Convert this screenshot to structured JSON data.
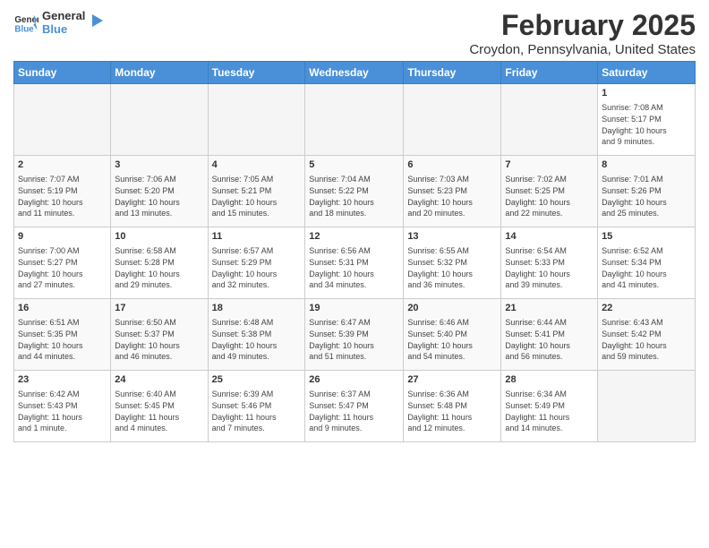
{
  "header": {
    "logo_line1": "General",
    "logo_line2": "Blue",
    "title": "February 2025",
    "subtitle": "Croydon, Pennsylvania, United States"
  },
  "weekdays": [
    "Sunday",
    "Monday",
    "Tuesday",
    "Wednesday",
    "Thursday",
    "Friday",
    "Saturday"
  ],
  "weeks": [
    [
      {
        "day": "",
        "info": ""
      },
      {
        "day": "",
        "info": ""
      },
      {
        "day": "",
        "info": ""
      },
      {
        "day": "",
        "info": ""
      },
      {
        "day": "",
        "info": ""
      },
      {
        "day": "",
        "info": ""
      },
      {
        "day": "1",
        "info": "Sunrise: 7:08 AM\nSunset: 5:17 PM\nDaylight: 10 hours\nand 9 minutes."
      }
    ],
    [
      {
        "day": "2",
        "info": "Sunrise: 7:07 AM\nSunset: 5:19 PM\nDaylight: 10 hours\nand 11 minutes."
      },
      {
        "day": "3",
        "info": "Sunrise: 7:06 AM\nSunset: 5:20 PM\nDaylight: 10 hours\nand 13 minutes."
      },
      {
        "day": "4",
        "info": "Sunrise: 7:05 AM\nSunset: 5:21 PM\nDaylight: 10 hours\nand 15 minutes."
      },
      {
        "day": "5",
        "info": "Sunrise: 7:04 AM\nSunset: 5:22 PM\nDaylight: 10 hours\nand 18 minutes."
      },
      {
        "day": "6",
        "info": "Sunrise: 7:03 AM\nSunset: 5:23 PM\nDaylight: 10 hours\nand 20 minutes."
      },
      {
        "day": "7",
        "info": "Sunrise: 7:02 AM\nSunset: 5:25 PM\nDaylight: 10 hours\nand 22 minutes."
      },
      {
        "day": "8",
        "info": "Sunrise: 7:01 AM\nSunset: 5:26 PM\nDaylight: 10 hours\nand 25 minutes."
      }
    ],
    [
      {
        "day": "9",
        "info": "Sunrise: 7:00 AM\nSunset: 5:27 PM\nDaylight: 10 hours\nand 27 minutes."
      },
      {
        "day": "10",
        "info": "Sunrise: 6:58 AM\nSunset: 5:28 PM\nDaylight: 10 hours\nand 29 minutes."
      },
      {
        "day": "11",
        "info": "Sunrise: 6:57 AM\nSunset: 5:29 PM\nDaylight: 10 hours\nand 32 minutes."
      },
      {
        "day": "12",
        "info": "Sunrise: 6:56 AM\nSunset: 5:31 PM\nDaylight: 10 hours\nand 34 minutes."
      },
      {
        "day": "13",
        "info": "Sunrise: 6:55 AM\nSunset: 5:32 PM\nDaylight: 10 hours\nand 36 minutes."
      },
      {
        "day": "14",
        "info": "Sunrise: 6:54 AM\nSunset: 5:33 PM\nDaylight: 10 hours\nand 39 minutes."
      },
      {
        "day": "15",
        "info": "Sunrise: 6:52 AM\nSunset: 5:34 PM\nDaylight: 10 hours\nand 41 minutes."
      }
    ],
    [
      {
        "day": "16",
        "info": "Sunrise: 6:51 AM\nSunset: 5:35 PM\nDaylight: 10 hours\nand 44 minutes."
      },
      {
        "day": "17",
        "info": "Sunrise: 6:50 AM\nSunset: 5:37 PM\nDaylight: 10 hours\nand 46 minutes."
      },
      {
        "day": "18",
        "info": "Sunrise: 6:48 AM\nSunset: 5:38 PM\nDaylight: 10 hours\nand 49 minutes."
      },
      {
        "day": "19",
        "info": "Sunrise: 6:47 AM\nSunset: 5:39 PM\nDaylight: 10 hours\nand 51 minutes."
      },
      {
        "day": "20",
        "info": "Sunrise: 6:46 AM\nSunset: 5:40 PM\nDaylight: 10 hours\nand 54 minutes."
      },
      {
        "day": "21",
        "info": "Sunrise: 6:44 AM\nSunset: 5:41 PM\nDaylight: 10 hours\nand 56 minutes."
      },
      {
        "day": "22",
        "info": "Sunrise: 6:43 AM\nSunset: 5:42 PM\nDaylight: 10 hours\nand 59 minutes."
      }
    ],
    [
      {
        "day": "23",
        "info": "Sunrise: 6:42 AM\nSunset: 5:43 PM\nDaylight: 11 hours\nand 1 minute."
      },
      {
        "day": "24",
        "info": "Sunrise: 6:40 AM\nSunset: 5:45 PM\nDaylight: 11 hours\nand 4 minutes."
      },
      {
        "day": "25",
        "info": "Sunrise: 6:39 AM\nSunset: 5:46 PM\nDaylight: 11 hours\nand 7 minutes."
      },
      {
        "day": "26",
        "info": "Sunrise: 6:37 AM\nSunset: 5:47 PM\nDaylight: 11 hours\nand 9 minutes."
      },
      {
        "day": "27",
        "info": "Sunrise: 6:36 AM\nSunset: 5:48 PM\nDaylight: 11 hours\nand 12 minutes."
      },
      {
        "day": "28",
        "info": "Sunrise: 6:34 AM\nSunset: 5:49 PM\nDaylight: 11 hours\nand 14 minutes."
      },
      {
        "day": "",
        "info": ""
      }
    ]
  ]
}
